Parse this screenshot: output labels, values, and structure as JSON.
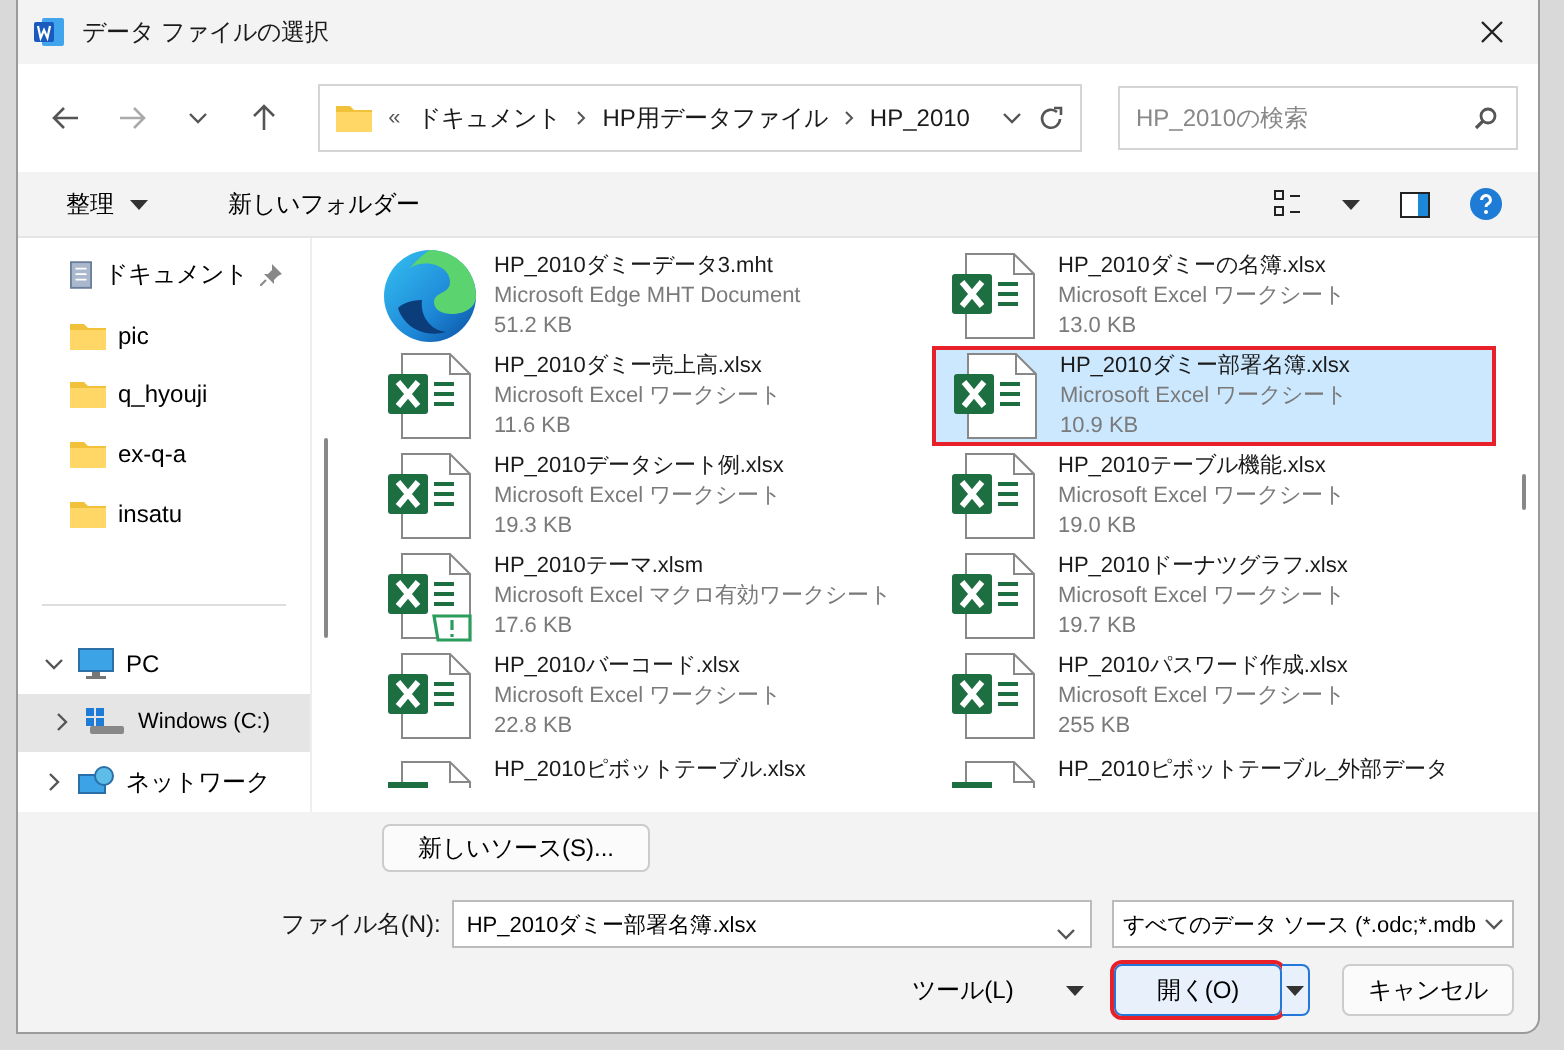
{
  "window": {
    "title": "データ ファイルの選択"
  },
  "nav": {
    "path": [
      "ドキュメント",
      "HP用データファイル",
      "HP_2010"
    ],
    "overflow": "«",
    "search_placeholder": "HP_2010の検索"
  },
  "toolbar": {
    "organize": "整理",
    "new_folder": "新しいフォルダー"
  },
  "sidebar": {
    "items": [
      {
        "kind": "document",
        "label": "ドキュメント",
        "pinned": true,
        "selected": false
      },
      {
        "kind": "folder",
        "label": "pic",
        "selected": false
      },
      {
        "kind": "folder",
        "label": "q_hyouji",
        "selected": false
      },
      {
        "kind": "folder",
        "label": "ex-q-a",
        "selected": false
      },
      {
        "kind": "folder",
        "label": "insatu",
        "selected": false
      },
      {
        "kind": "pc",
        "label": "PC",
        "expanded": true,
        "selected": false,
        "children": [
          {
            "kind": "drive",
            "label": "Windows (C:)",
            "expanded": false,
            "selected": true
          }
        ]
      },
      {
        "kind": "network",
        "label": "ネットワーク",
        "expanded": false,
        "selected": false
      }
    ]
  },
  "files": [
    {
      "kind": "mht",
      "name": "HP_2010ダミーデータ3.mht",
      "type": "Microsoft Edge MHT Document",
      "size": "51.2 KB",
      "selected": false,
      "marked": false
    },
    {
      "kind": "xlsx",
      "name": "HP_2010ダミーの名簿.xlsx",
      "type": "Microsoft Excel ワークシート",
      "size": "13.0 KB",
      "selected": false,
      "marked": false
    },
    {
      "kind": "xlsx",
      "name": "HP_2010ダミー売上高.xlsx",
      "type": "Microsoft Excel ワークシート",
      "size": "11.6 KB",
      "selected": false,
      "marked": false
    },
    {
      "kind": "xlsx",
      "name": "HP_2010ダミー部署名簿.xlsx",
      "type": "Microsoft Excel ワークシート",
      "size": "10.9 KB",
      "selected": true,
      "marked": true
    },
    {
      "kind": "xlsx",
      "name": "HP_2010データシート例.xlsx",
      "type": "Microsoft Excel ワークシート",
      "size": "19.3 KB",
      "selected": false,
      "marked": false
    },
    {
      "kind": "xlsx",
      "name": "HP_2010テーブル機能.xlsx",
      "type": "Microsoft Excel ワークシート",
      "size": "19.0 KB",
      "selected": false,
      "marked": false
    },
    {
      "kind": "xlsm",
      "name": "HP_2010テーマ.xlsm",
      "type": "Microsoft Excel マクロ有効ワークシート",
      "size": "17.6 KB",
      "selected": false,
      "marked": false
    },
    {
      "kind": "xlsx",
      "name": "HP_2010ドーナツグラフ.xlsx",
      "type": "Microsoft Excel ワークシート",
      "size": "19.7 KB",
      "selected": false,
      "marked": false
    },
    {
      "kind": "xlsx",
      "name": "HP_2010バーコード.xlsx",
      "type": "Microsoft Excel ワークシート",
      "size": "22.8 KB",
      "selected": false,
      "marked": false
    },
    {
      "kind": "xlsx",
      "name": "HP_2010パスワード作成.xlsx",
      "type": "Microsoft Excel ワークシート",
      "size": "255 KB",
      "selected": false,
      "marked": false
    },
    {
      "kind": "xlsx",
      "name": "HP_2010ピボットテーブル.xlsx",
      "selected": false,
      "marked": false
    },
    {
      "kind": "xlsx",
      "name": "HP_2010ピボットテーブル_外部データ",
      "selected": false,
      "marked": false
    }
  ],
  "new_source_button": "新しいソース(S)...",
  "filename": {
    "label": "ファイル名(N):",
    "value": "HP_2010ダミー部署名簿.xlsx"
  },
  "filter": {
    "value": "すべてのデータ ソース (*.odc;*.mdb"
  },
  "buttons": [
    {
      "kind": "tools",
      "label": "ツール(L)",
      "marked": false
    },
    {
      "kind": "open",
      "label": "開く(O)",
      "marked": true
    },
    {
      "kind": "cancel",
      "label": "キャンセル",
      "marked": false
    }
  ]
}
